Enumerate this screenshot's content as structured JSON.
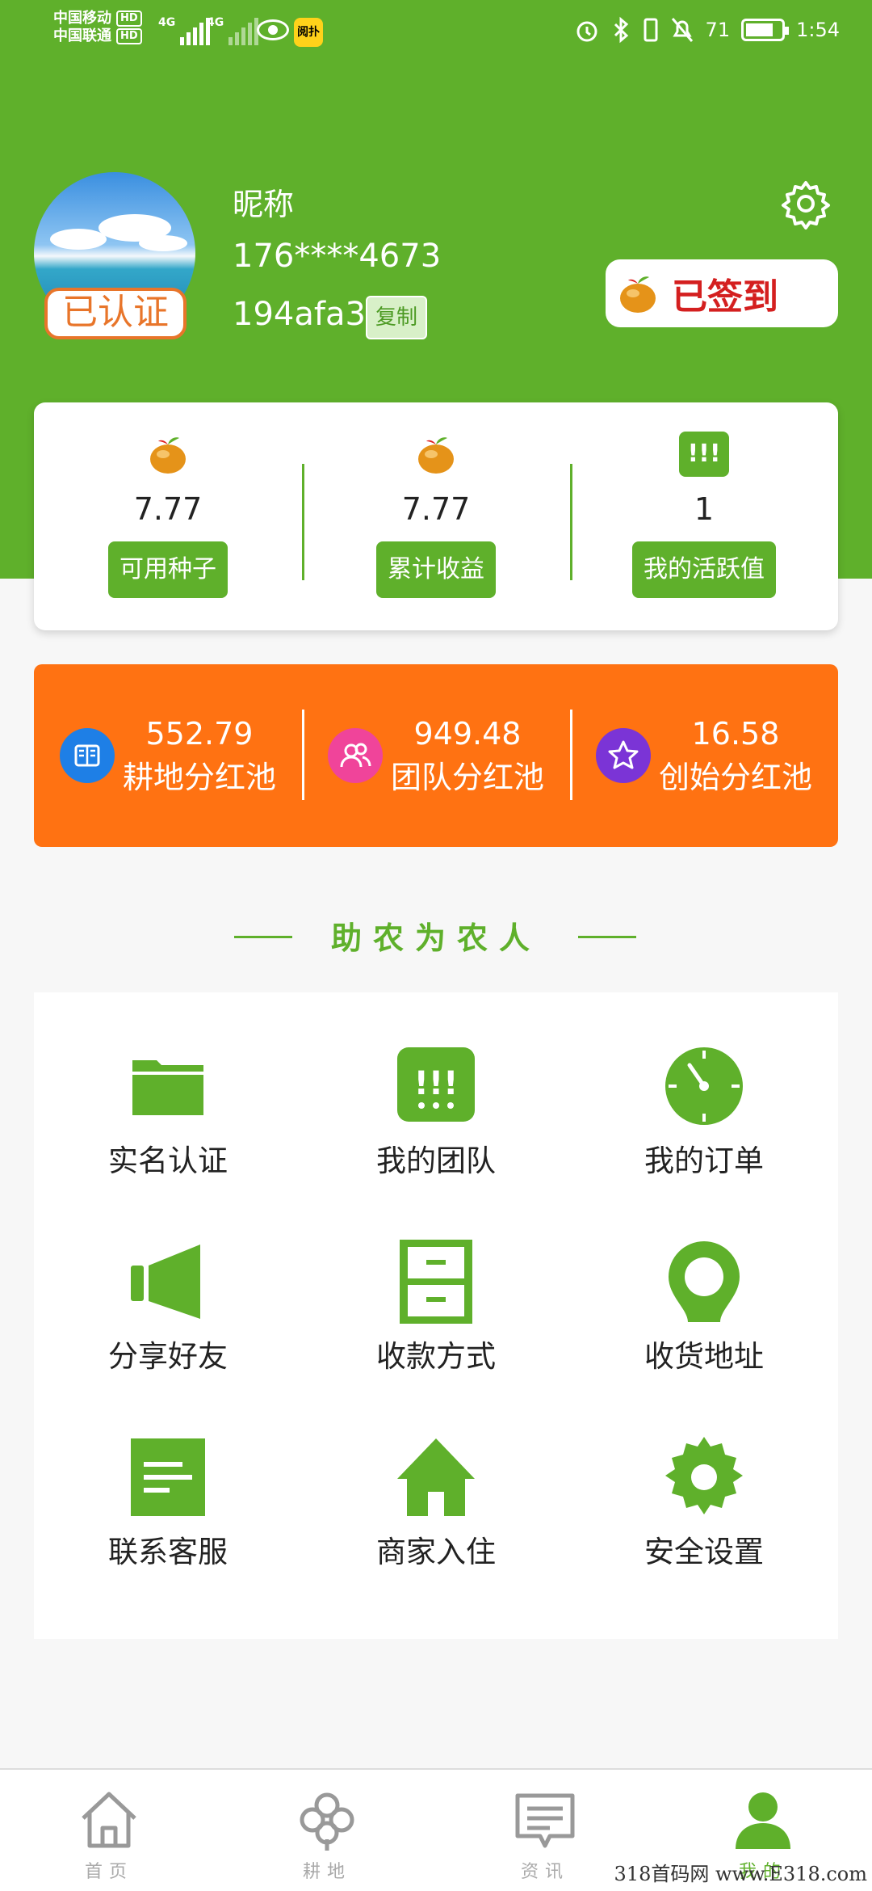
{
  "status_bar": {
    "carrier1": "中国移动",
    "carrier2": "中国联通",
    "hd": "HD",
    "net1": "4G",
    "net2": "4G",
    "app_icon_text": "阅扑",
    "battery": "71",
    "time": "1:54"
  },
  "profile": {
    "verified_badge": "已认证",
    "nickname": "昵称",
    "phone": "176****4673",
    "uid": "194afa3",
    "copy_label": "复制",
    "signin_label": "已签到"
  },
  "stats": [
    {
      "value": "7.77",
      "label": "可用种子",
      "icon": "seed-icon"
    },
    {
      "value": "7.77",
      "label": "累计收益",
      "icon": "seed-icon"
    },
    {
      "value": "1",
      "label": "我的活跃值",
      "icon": "activity-icon",
      "glyph": "!!!"
    }
  ],
  "pools": [
    {
      "value": "552.79",
      "label": "耕地分红池",
      "icon": "book-icon",
      "color": "#1e7fe6"
    },
    {
      "value": "949.48",
      "label": "团队分红池",
      "icon": "people-icon",
      "color": "#f0449a"
    },
    {
      "value": "16.58",
      "label": "创始分红池",
      "icon": "star-icon",
      "color": "#7b34d6"
    }
  ],
  "section_title": "助农为农人",
  "menu": [
    {
      "label": "实名认证",
      "icon": "folder-icon"
    },
    {
      "label": "我的团队",
      "icon": "team-icon"
    },
    {
      "label": "我的订单",
      "icon": "clock-icon"
    },
    {
      "label": "分享好友",
      "icon": "share-icon"
    },
    {
      "label": "收款方式",
      "icon": "cabinet-icon"
    },
    {
      "label": "收货地址",
      "icon": "location-icon"
    },
    {
      "label": "联系客服",
      "icon": "message-icon"
    },
    {
      "label": "商家入住",
      "icon": "home-icon"
    },
    {
      "label": "安全设置",
      "icon": "gear-icon"
    }
  ],
  "nav": [
    {
      "label": "首页",
      "icon": "home-icon"
    },
    {
      "label": "耕地",
      "icon": "clover-icon"
    },
    {
      "label": "资讯",
      "icon": "news-icon"
    },
    {
      "label": "我的",
      "icon": "user-icon"
    }
  ],
  "watermark": "318首码网 www.E318.com",
  "colors": {
    "primary": "#5fb02b",
    "orange": "#ff7212",
    "signin_text": "#d41f1f",
    "verified": "#e8752a"
  }
}
